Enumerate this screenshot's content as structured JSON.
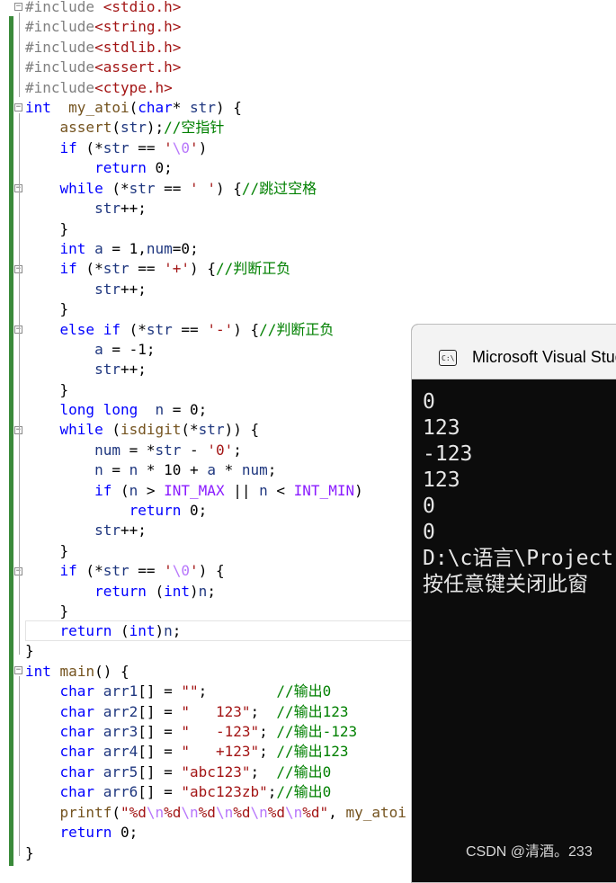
{
  "code": {
    "lines": [
      [
        [
          "pp",
          "#include "
        ],
        [
          "inc",
          "<stdio.h>"
        ]
      ],
      [
        [
          "pp",
          "#include"
        ],
        [
          "inc",
          "<string.h>"
        ]
      ],
      [
        [
          "pp",
          "#include"
        ],
        [
          "inc",
          "<stdlib.h>"
        ]
      ],
      [
        [
          "pp",
          "#include"
        ],
        [
          "inc",
          "<assert.h>"
        ]
      ],
      [
        [
          "pp",
          "#include"
        ],
        [
          "inc",
          "<ctype.h>"
        ]
      ],
      [
        [
          "kw",
          "int"
        ],
        [
          "",
          "  "
        ],
        [
          "fn",
          "my_atoi"
        ],
        [
          "",
          "("
        ],
        [
          "kw",
          "char"
        ],
        [
          "",
          "* "
        ],
        [
          "id",
          "str"
        ],
        [
          "",
          ") {"
        ]
      ],
      [
        [
          "",
          "    "
        ],
        [
          "fn",
          "assert"
        ],
        [
          "",
          "("
        ],
        [
          "id",
          "str"
        ],
        [
          "",
          ");"
        ],
        [
          "cmt",
          "//空指针"
        ]
      ],
      [
        [
          "",
          "    "
        ],
        [
          "kw",
          "if"
        ],
        [
          "",
          " (*"
        ],
        [
          "id",
          "str"
        ],
        [
          "",
          " == "
        ],
        [
          "str",
          "'"
        ],
        [
          "esc",
          "\\0"
        ],
        [
          "str",
          "'"
        ],
        [
          "",
          ")"
        ]
      ],
      [
        [
          "",
          "        "
        ],
        [
          "kw",
          "return"
        ],
        [
          "",
          " 0;"
        ]
      ],
      [
        [
          "",
          "    "
        ],
        [
          "kw",
          "while"
        ],
        [
          "",
          " (*"
        ],
        [
          "id",
          "str"
        ],
        [
          "",
          " == "
        ],
        [
          "str",
          "' '"
        ],
        [
          "",
          ") {"
        ],
        [
          "cmt",
          "//跳过空格"
        ]
      ],
      [
        [
          "",
          "        "
        ],
        [
          "id",
          "str"
        ],
        [
          "",
          "++;"
        ]
      ],
      [
        [
          "",
          "    }"
        ]
      ],
      [
        [
          "",
          "    "
        ],
        [
          "kw",
          "int"
        ],
        [
          "",
          " "
        ],
        [
          "id",
          "a"
        ],
        [
          "",
          " = 1,"
        ],
        [
          "id",
          "num"
        ],
        [
          "",
          "=0;"
        ]
      ],
      [
        [
          "",
          "    "
        ],
        [
          "kw",
          "if"
        ],
        [
          "",
          " (*"
        ],
        [
          "id",
          "str"
        ],
        [
          "",
          " == "
        ],
        [
          "str",
          "'+'"
        ],
        [
          "",
          ") {"
        ],
        [
          "cmt",
          "//判断正负"
        ]
      ],
      [
        [
          "",
          "        "
        ],
        [
          "id",
          "str"
        ],
        [
          "",
          "++;"
        ]
      ],
      [
        [
          "",
          "    }"
        ]
      ],
      [
        [
          "",
          "    "
        ],
        [
          "kw",
          "else if"
        ],
        [
          "",
          " (*"
        ],
        [
          "id",
          "str"
        ],
        [
          "",
          " == "
        ],
        [
          "str",
          "'-'"
        ],
        [
          "",
          ") {"
        ],
        [
          "cmt",
          "//判断正负"
        ]
      ],
      [
        [
          "",
          "        "
        ],
        [
          "id",
          "a"
        ],
        [
          "",
          " = -1;"
        ]
      ],
      [
        [
          "",
          "        "
        ],
        [
          "id",
          "str"
        ],
        [
          "",
          "++;"
        ]
      ],
      [
        [
          "",
          "    }"
        ]
      ],
      [
        [
          "",
          "    "
        ],
        [
          "kw",
          "long long"
        ],
        [
          "",
          "  "
        ],
        [
          "id",
          "n"
        ],
        [
          "",
          " = 0;"
        ]
      ],
      [
        [
          "",
          "    "
        ],
        [
          "kw",
          "while"
        ],
        [
          "",
          " ("
        ],
        [
          "fn",
          "isdigit"
        ],
        [
          "",
          "(*"
        ],
        [
          "id",
          "str"
        ],
        [
          "",
          ")) {"
        ]
      ],
      [
        [
          "",
          "        "
        ],
        [
          "id",
          "num"
        ],
        [
          "",
          " = *"
        ],
        [
          "id",
          "str"
        ],
        [
          "",
          " - "
        ],
        [
          "str",
          "'0'"
        ],
        [
          "",
          ";"
        ]
      ],
      [
        [
          "",
          "        "
        ],
        [
          "id",
          "n"
        ],
        [
          "",
          " = "
        ],
        [
          "id",
          "n"
        ],
        [
          "",
          " * 10 + "
        ],
        [
          "id",
          "a"
        ],
        [
          "",
          " * "
        ],
        [
          "id",
          "num"
        ],
        [
          "",
          ";"
        ]
      ],
      [
        [
          "",
          "        "
        ],
        [
          "kw",
          "if"
        ],
        [
          "",
          " ("
        ],
        [
          "id",
          "n"
        ],
        [
          "",
          " > "
        ],
        [
          "mac",
          "INT_MAX"
        ],
        [
          "",
          " || "
        ],
        [
          "id",
          "n"
        ],
        [
          "",
          " < "
        ],
        [
          "mac",
          "INT_MIN"
        ],
        [
          "",
          ")"
        ]
      ],
      [
        [
          "",
          "            "
        ],
        [
          "kw",
          "return"
        ],
        [
          "",
          " 0;"
        ]
      ],
      [
        [
          "",
          "        "
        ],
        [
          "id",
          "str"
        ],
        [
          "",
          "++;"
        ]
      ],
      [
        [
          "",
          "    }"
        ]
      ],
      [
        [
          "",
          "    "
        ],
        [
          "kw",
          "if"
        ],
        [
          "",
          " (*"
        ],
        [
          "id",
          "str"
        ],
        [
          "",
          " == "
        ],
        [
          "str",
          "'"
        ],
        [
          "esc",
          "\\0"
        ],
        [
          "str",
          "'"
        ],
        [
          "",
          ") {"
        ]
      ],
      [
        [
          "",
          "        "
        ],
        [
          "kw",
          "return"
        ],
        [
          "",
          " ("
        ],
        [
          "kw",
          "int"
        ],
        [
          "",
          ")"
        ],
        [
          "id",
          "n"
        ],
        [
          "",
          ";"
        ]
      ],
      [
        [
          "",
          "    }"
        ]
      ],
      [
        [
          "",
          "    "
        ],
        [
          "kw",
          "return"
        ],
        [
          "",
          " ("
        ],
        [
          "kw",
          "int"
        ],
        [
          "",
          ")"
        ],
        [
          "id",
          "n"
        ],
        [
          "",
          ";"
        ]
      ],
      [
        [
          "",
          "}"
        ]
      ],
      [
        [
          "kw",
          "int"
        ],
        [
          "",
          " "
        ],
        [
          "fn",
          "main"
        ],
        [
          "",
          "() {"
        ]
      ],
      [
        [
          "",
          "    "
        ],
        [
          "kw",
          "char"
        ],
        [
          "",
          " "
        ],
        [
          "id",
          "arr1"
        ],
        [
          "",
          "[] = "
        ],
        [
          "str",
          "\"\""
        ],
        [
          "",
          ";        "
        ],
        [
          "cmt",
          "//输出0"
        ]
      ],
      [
        [
          "",
          "    "
        ],
        [
          "kw",
          "char"
        ],
        [
          "",
          " "
        ],
        [
          "id",
          "arr2"
        ],
        [
          "",
          "[] = "
        ],
        [
          "str",
          "\"   123\""
        ],
        [
          "",
          ";  "
        ],
        [
          "cmt",
          "//输出123"
        ]
      ],
      [
        [
          "",
          "    "
        ],
        [
          "kw",
          "char"
        ],
        [
          "",
          " "
        ],
        [
          "id",
          "arr3"
        ],
        [
          "",
          "[] = "
        ],
        [
          "str",
          "\"   -123\""
        ],
        [
          "",
          "; "
        ],
        [
          "cmt",
          "//输出-123"
        ]
      ],
      [
        [
          "",
          "    "
        ],
        [
          "kw",
          "char"
        ],
        [
          "",
          " "
        ],
        [
          "id",
          "arr4"
        ],
        [
          "",
          "[] = "
        ],
        [
          "str",
          "\"   +123\""
        ],
        [
          "",
          "; "
        ],
        [
          "cmt",
          "//输出123"
        ]
      ],
      [
        [
          "",
          "    "
        ],
        [
          "kw",
          "char"
        ],
        [
          "",
          " "
        ],
        [
          "id",
          "arr5"
        ],
        [
          "",
          "[] = "
        ],
        [
          "str",
          "\"abc123\""
        ],
        [
          "",
          ";  "
        ],
        [
          "cmt",
          "//输出0"
        ]
      ],
      [
        [
          "",
          "    "
        ],
        [
          "kw",
          "char"
        ],
        [
          "",
          " "
        ],
        [
          "id",
          "arr6"
        ],
        [
          "",
          "[] = "
        ],
        [
          "str",
          "\"abc123zb\""
        ],
        [
          "",
          ";"
        ],
        [
          "cmt",
          "//输出0"
        ]
      ],
      [
        [
          "",
          "    "
        ],
        [
          "fn",
          "printf"
        ],
        [
          "",
          "("
        ],
        [
          "str",
          "\"%d"
        ],
        [
          "esc",
          "\\n"
        ],
        [
          "str",
          "%d"
        ],
        [
          "esc",
          "\\n"
        ],
        [
          "str",
          "%d"
        ],
        [
          "esc",
          "\\n"
        ],
        [
          "str",
          "%d"
        ],
        [
          "esc",
          "\\n"
        ],
        [
          "str",
          "%d"
        ],
        [
          "esc",
          "\\n"
        ],
        [
          "str",
          "%d\""
        ],
        [
          "",
          ", "
        ],
        [
          "fn",
          "my_atoi"
        ]
      ],
      [
        [
          "",
          "    "
        ],
        [
          "kw",
          "return"
        ],
        [
          "",
          " 0;"
        ]
      ],
      [
        [
          "",
          "}"
        ]
      ]
    ]
  },
  "console": {
    "title": "Microsoft Visual Studio Debug Console",
    "output": [
      "0",
      "123",
      "-123",
      "123",
      "0",
      "0",
      "D:\\c语言\\Project",
      "按任意键关闭此窗"
    ]
  },
  "watermark": "CSDN @清酒。233",
  "colors": {
    "keyword": "#0000ff",
    "string": "#a31515",
    "comment": "#008000",
    "function": "#74531f",
    "identifier": "#1f377f",
    "macro": "#8a1bff",
    "console_bg": "#0c0c0c"
  }
}
